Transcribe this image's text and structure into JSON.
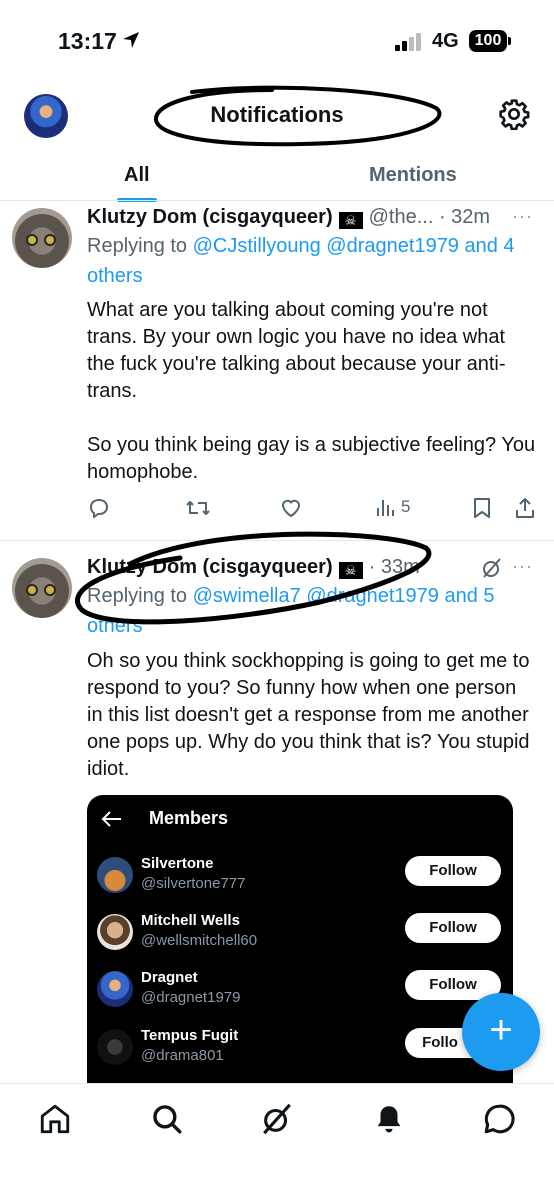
{
  "status_bar": {
    "time": "13:17",
    "network": "4G",
    "battery": "100"
  },
  "header": {
    "title": "Notifications"
  },
  "tabs": [
    {
      "label": "All",
      "active": true
    },
    {
      "label": "Mentions",
      "active": false
    }
  ],
  "posts": [
    {
      "author": "Klutzy Dom (cisgayqueer)",
      "handle": "@the...",
      "time": "· 32m",
      "more": "···",
      "reply_prefix": "Replying to ",
      "reply_to": "@CJstillyoung @dragnet1979 and 4 others",
      "text_p1": "What are you talking about coming you're not trans. By your own logic you have no idea what the fuck you're talking about because your anti-trans.",
      "text_p2": "So you think being gay is a subjective feeling? You homophobe.",
      "views": "5"
    },
    {
      "author": "Klutzy Dom (cisgayqueer)",
      "time": "· 33m",
      "more": "···",
      "reply_prefix": "Replying to ",
      "reply_to": "@swimella7 @dragnet1979 and 5 others",
      "text_p1": "Oh so you think sockhopping is going to get me to respond to you? So funny how when one person in this list doesn't get a response from me another one pops up. Why do you think that is? You stupid idiot."
    }
  ],
  "members_card": {
    "title": "Members",
    "members": [
      {
        "name": "Silvertone",
        "handle": "@silvertone777",
        "button": "Follow"
      },
      {
        "name": "Mitchell Wells",
        "handle": "@wellsmitchell60",
        "button": "Follow"
      },
      {
        "name": "Dragnet",
        "handle": "@dragnet1979",
        "button": "Follow"
      },
      {
        "name": "Tempus Fugit",
        "handle": "@drama801",
        "button": "Follo"
      }
    ]
  },
  "fab": {
    "label": "+"
  },
  "bottom_nav": [
    "home-icon",
    "search-icon",
    "grok-icon",
    "notifications-icon",
    "messages-icon"
  ],
  "colors": {
    "accent": "#1d9bf0",
    "text": "#0f1419",
    "muted": "#536471"
  }
}
